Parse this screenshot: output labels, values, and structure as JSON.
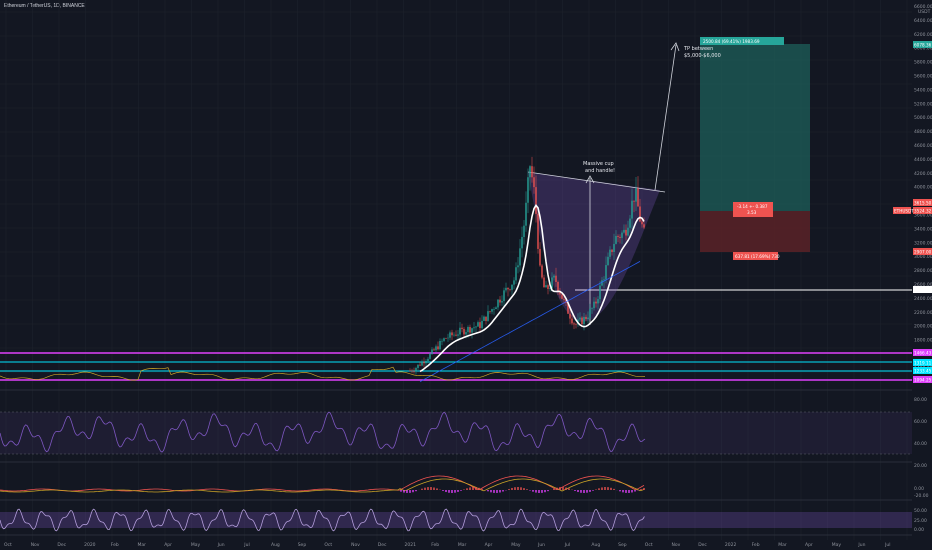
{
  "symbol": "Ethereum / TetherUS, 1D, BINANCE",
  "price_axis": {
    "currency": "USDT",
    "ticks": [
      "6600.00",
      "6400.00",
      "6200.00",
      "6000.00",
      "5800.00",
      "5600.00",
      "5400.00",
      "5200.00",
      "5000.00",
      "4800.00",
      "4600.00",
      "4400.00",
      "4200.00",
      "4000.00",
      "3800.00",
      "3600.00",
      "3400.00",
      "3200.00",
      "3000.00",
      "2800.00",
      "2600.00",
      "2400.00",
      "2200.00",
      "2000.00",
      "1800.00",
      "1600.00",
      "1400.00"
    ],
    "badges": {
      "target": "6078.36",
      "current": "3615.50",
      "current2": "3524.32",
      "symbol_tag": "ETHUSDT",
      "stop": "2907.00",
      "support": "2402.59",
      "magenta1": "1466.43",
      "magenta2": "1094.25",
      "cyan1": "1319.11",
      "cyan2": "1233.45"
    }
  },
  "time_axis": [
    "Oct",
    "Nov",
    "Dec",
    "2020",
    "Feb",
    "Mar",
    "Apr",
    "May",
    "Jun",
    "Jul",
    "Aug",
    "Sep",
    "Oct",
    "Nov",
    "Dec",
    "2021",
    "Feb",
    "Mar",
    "Apr",
    "May",
    "Jun",
    "Jul",
    "Aug",
    "Sep",
    "Oct",
    "Nov",
    "Dec",
    "2022",
    "Feb",
    "Mar",
    "Apr",
    "May",
    "Jun",
    "Jul"
  ],
  "annotations": {
    "cup": "Massive cup\nand handle!",
    "tp": "TP  between\n$5,000-$6,000"
  },
  "position": {
    "target_label": "2500.84 (69.41%) 1983.69",
    "stop_label": "637.81 (17.69%) 730",
    "center_label": "-3.14 +- 0.387\n3.53"
  },
  "indicators": {
    "rsi_ticks": [
      "80.00",
      "60.00",
      "40.00"
    ],
    "macd_ticks": [
      "20.00",
      "0.00",
      "-20.00"
    ],
    "stoch_ticks": [
      "50.00",
      "25.00",
      "0.00"
    ]
  },
  "colors": {
    "background": "#131722",
    "grid": "#1e222d",
    "up": "#26a69a",
    "down": "#ef5350",
    "magenta": "#e040fb",
    "cyan": "#00e5ff",
    "ma_white": "#ffffff",
    "rsi": "#7e57c2",
    "tp_zone": "#1e5f5a",
    "sl_zone": "#5a2227"
  },
  "chart_data": {
    "type": "candlestick",
    "title": "Ethereum / TetherUS, 1D, BINANCE",
    "x": [
      "2021-01",
      "2021-02",
      "2021-03",
      "2021-04",
      "2021-05",
      "2021-06",
      "2021-07",
      "2021-08",
      "2021-09"
    ],
    "close_approx": [
      1300,
      1450,
      1800,
      2700,
      2700,
      2250,
      2400,
      3400,
      3615
    ],
    "horizontal_levels": [
      6078.36,
      3615.5,
      2907.0,
      2402.59,
      1466.43,
      1319.11,
      1233.45,
      1094.25
    ],
    "ylim": [
      1000,
      6700
    ],
    "grid": true
  }
}
